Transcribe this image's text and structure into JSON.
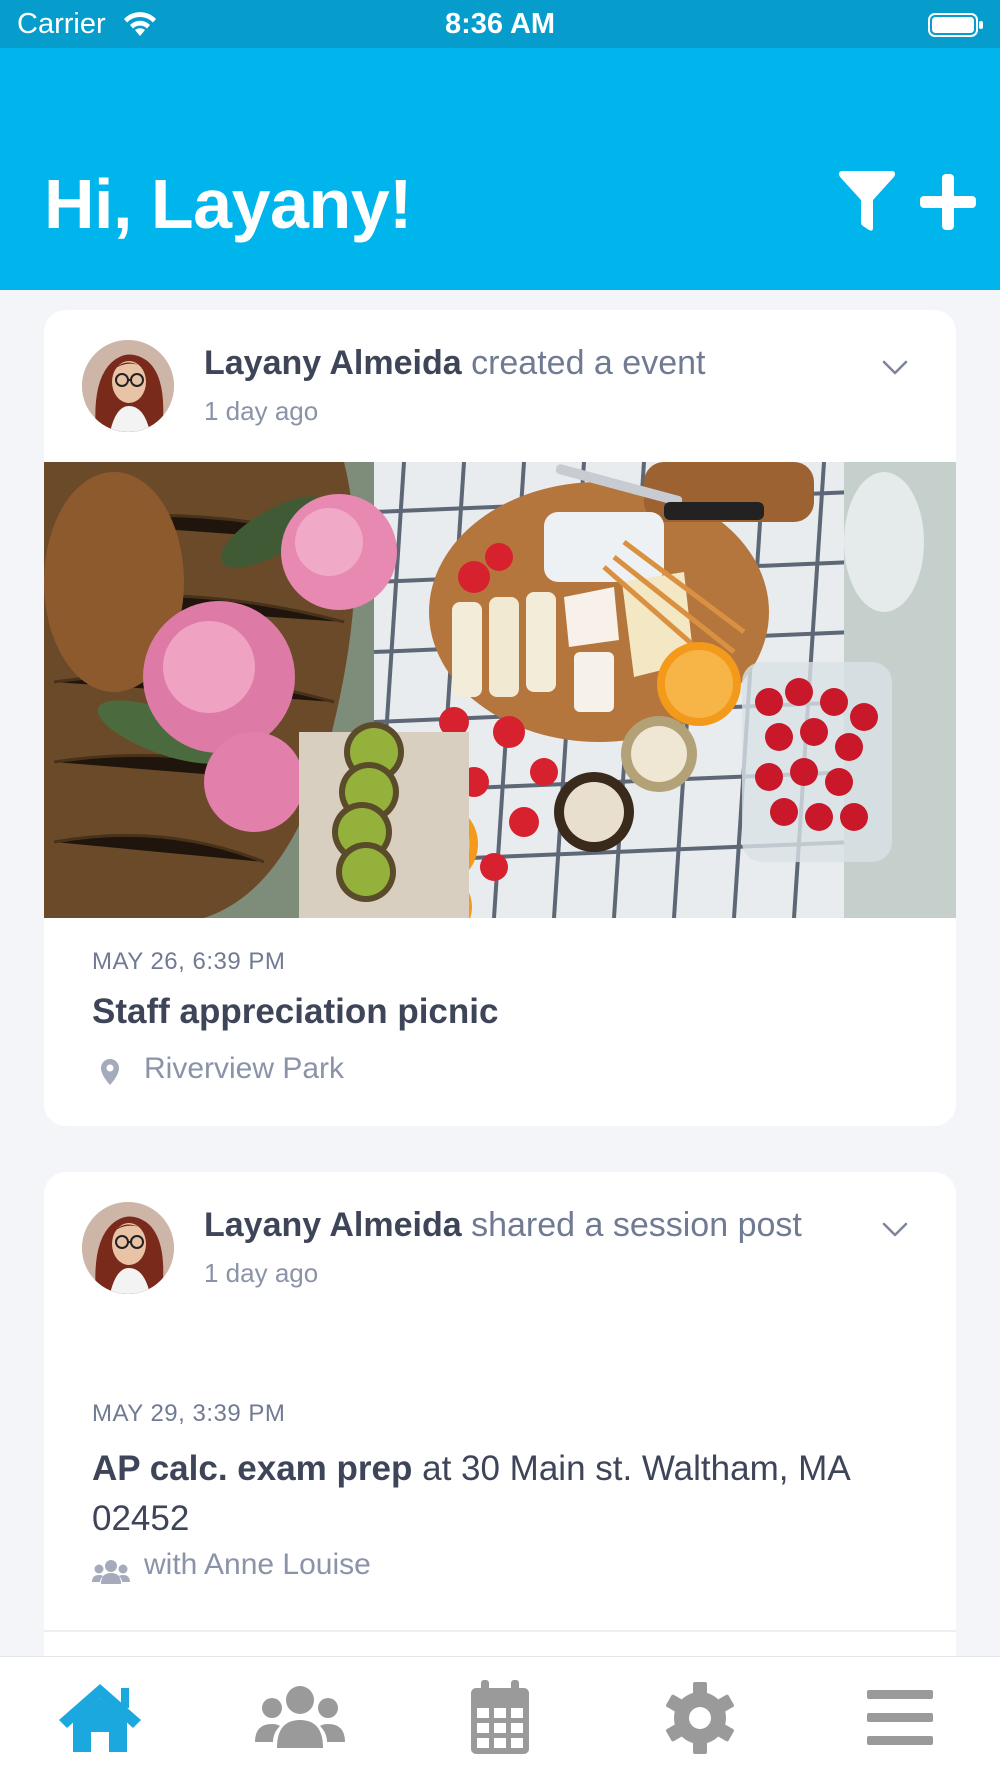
{
  "status_bar": {
    "carrier": "Carrier",
    "time": "8:36 AM"
  },
  "header": {
    "greeting": "Hi, Layany!"
  },
  "colors": {
    "accent": "#00b4ec",
    "status_bar": "#069ccc",
    "active_tab": "#1aa8df",
    "inactive_tab": "#9a9a9a"
  },
  "feed": [
    {
      "author": "Layany Almeida",
      "action": "created a event",
      "time_ago": "1 day ago",
      "date": "MAY 26, 6:39 PM",
      "title": "Staff appreciation picnic",
      "location": "Riverview Park"
    },
    {
      "author": "Layany Almeida",
      "action": "shared a session post",
      "time_ago": "1 day ago",
      "date": "MAY 29, 3:39 PM",
      "title": "AP calc. exam prep",
      "location_text": "at 30 Main st. Waltham, MA 02452",
      "with": "with Anne Louise"
    }
  ],
  "tab_bar": {
    "active": "home",
    "tabs": [
      {
        "id": "home",
        "icon": "home-icon"
      },
      {
        "id": "groups",
        "icon": "users-icon"
      },
      {
        "id": "calendar",
        "icon": "calendar-icon"
      },
      {
        "id": "settings",
        "icon": "gear-icon"
      },
      {
        "id": "menu",
        "icon": "hamburger-menu-icon"
      }
    ]
  }
}
